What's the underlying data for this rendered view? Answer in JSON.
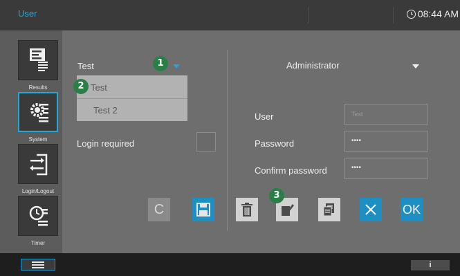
{
  "header": {
    "title": "User",
    "time": "08:44 AM"
  },
  "sidebar": {
    "items": [
      {
        "label": "Results",
        "icon": "results-icon"
      },
      {
        "label": "System",
        "icon": "system-icon"
      },
      {
        "label": "Login/Logout",
        "icon": "login-logout-icon"
      },
      {
        "label": "Timer",
        "icon": "timer-icon"
      }
    ],
    "active": "System"
  },
  "left_panel": {
    "selected_user": "Test",
    "user_list": [
      "Test",
      "Test 2"
    ],
    "login_required_label": "Login required",
    "login_required_checked": false
  },
  "right_panel": {
    "role": "Administrator",
    "user_label": "User",
    "user_value": "Test",
    "password_label": "Password",
    "password_value": "••••",
    "confirm_label": "Confirm password",
    "confirm_value": "••••"
  },
  "buttons": {
    "clear_label": "C",
    "ok_label": "OK"
  },
  "callouts": [
    "1",
    "2",
    "3"
  ],
  "bottom": {
    "info_label": "i"
  },
  "colors": {
    "accent": "#1e8fc2",
    "callout": "#2a7f47",
    "title": "#20a9d6"
  }
}
